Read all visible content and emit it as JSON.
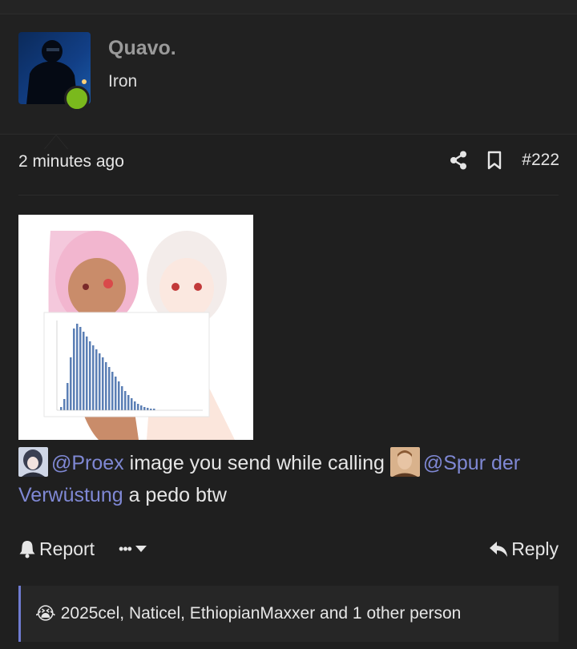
{
  "author": {
    "username": "Quavo.",
    "title": "Iron",
    "status": "online"
  },
  "post": {
    "time": "2 minutes ago",
    "number": "#222",
    "body": {
      "mention_1": "@Proex",
      "text_1": " image you send while calling ",
      "mention_2": "@Spur der Verwüstung",
      "text_2": " a pedo btw"
    }
  },
  "actions": {
    "report": "Report",
    "more": "•••",
    "reply": "Reply"
  },
  "reactions": {
    "emoji": "😭",
    "text": "2025cel, Naticel, EthiopianMaxxer and 1 other person"
  },
  "icons": {
    "share": "share-icon",
    "bookmark": "bookmark-icon",
    "bell": "bell-icon",
    "caret": "caret-down-icon",
    "reply": "reply-arrow-icon"
  },
  "colors": {
    "background": "#1f1f1f",
    "mention": "#7f88d4",
    "online": "#7ab91d",
    "reaction_accent": "#6f7bd1"
  }
}
